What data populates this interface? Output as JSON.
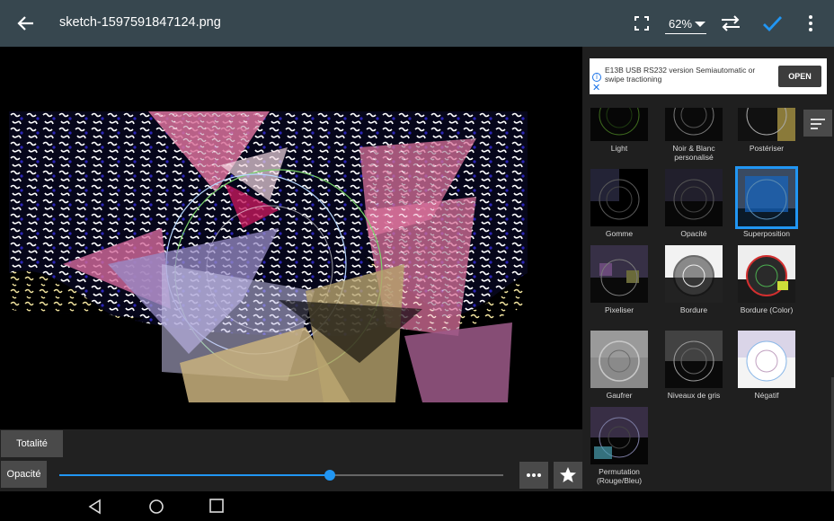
{
  "toolbar": {
    "title": "sketch-1597591847124.png",
    "zoom": "62%",
    "icons": [
      "arrow-back-icon",
      "fullscreen-icon",
      "dropdown-caret-icon",
      "swap-icon",
      "check-icon",
      "more-vert-icon"
    ],
    "accent_color": "#2196f3",
    "bg_color": "#37474f"
  },
  "ad": {
    "text": "E13B USB RS232 version Semiautomatic or swipe tractioning",
    "button": "OPEN"
  },
  "filters": [
    {
      "label": "Light"
    },
    {
      "label": "Noir & Blanc personalisé"
    },
    {
      "label": "Postériser"
    },
    {
      "label": "Gomme"
    },
    {
      "label": "Opacité"
    },
    {
      "label": "Superposition",
      "selected": true
    },
    {
      "label": "Pixeliser"
    },
    {
      "label": "Bordure"
    },
    {
      "label": "Bordure (Color)"
    },
    {
      "label": "Gaufrer"
    },
    {
      "label": "Niveaux de gris"
    },
    {
      "label": "Négatif"
    },
    {
      "label": "Permutation (Rouge/Bleu)"
    }
  ],
  "bottom": {
    "scope_button": "Totalité",
    "opacity_button": "Opacité",
    "opacity_value": 0.61,
    "more_button_icon": "more-horiz-icon",
    "favorite_button_icon": "star-icon"
  },
  "navbar": {
    "icons": [
      "nav-back-icon",
      "nav-home-icon",
      "nav-recents-icon"
    ]
  }
}
